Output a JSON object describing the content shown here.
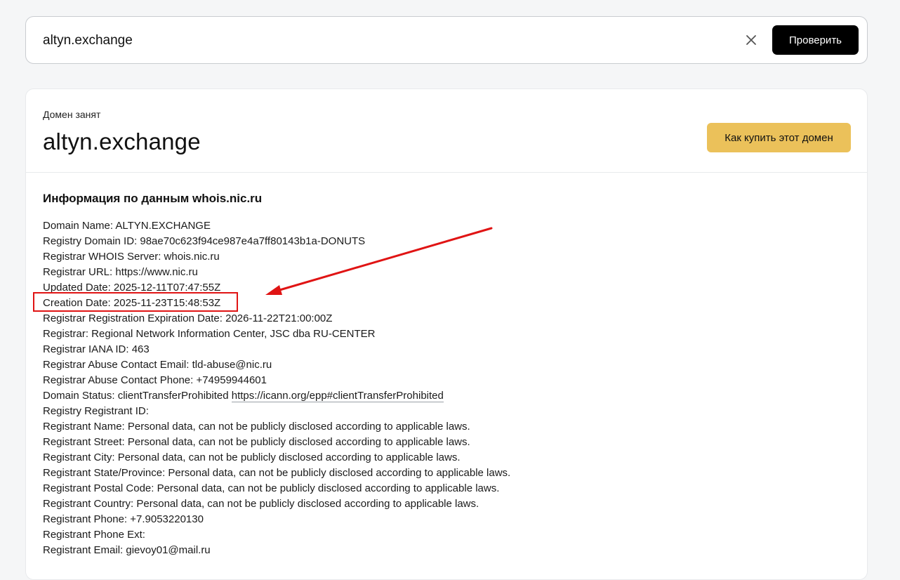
{
  "search": {
    "value": "altyn.exchange",
    "submit_label": "Проверить",
    "clear_icon": "close-icon"
  },
  "result": {
    "status": "Домен занят",
    "domain": "altyn.exchange",
    "buy_label": "Как купить этот домен",
    "buy_color": "#ebc15a"
  },
  "whois": {
    "heading": "Информация по данным whois.nic.ru",
    "lines": [
      {
        "text": "Domain Name: ALTYN.EXCHANGE"
      },
      {
        "text": "Registry Domain ID: 98ae70c623f94ce987e4a7ff80143b1a-DONUTS"
      },
      {
        "text": "Registrar WHOIS Server: whois.nic.ru"
      },
      {
        "text": "Registrar URL: https://www.nic.ru"
      },
      {
        "text": "Updated Date: 2025-12-11T07:47:55Z"
      },
      {
        "text": "Creation Date: 2025-11-23T15:48:53Z",
        "highlighted": true
      },
      {
        "text": "Registrar Registration Expiration Date: 2026-11-22T21:00:00Z"
      },
      {
        "text": "Registrar: Regional Network Information Center, JSC dba RU-CENTER"
      },
      {
        "text": "Registrar IANA ID: 463"
      },
      {
        "text": "Registrar Abuse Contact Email: tld-abuse@nic.ru"
      },
      {
        "text": "Registrar Abuse Contact Phone: +74959944601"
      },
      {
        "prefix": "Domain Status: clientTransferProhibited ",
        "link": "https://icann.org/epp#clientTransferProhibited"
      },
      {
        "text": "Registry Registrant ID:"
      },
      {
        "text": "Registrant Name: Personal data, can not be publicly disclosed according to applicable laws."
      },
      {
        "text": "Registrant Street: Personal data, can not be publicly disclosed according to applicable laws."
      },
      {
        "text": "Registrant City: Personal data, can not be publicly disclosed according to applicable laws."
      },
      {
        "text": "Registrant State/Province: Personal data, can not be publicly disclosed according to applicable laws."
      },
      {
        "text": "Registrant Postal Code: Personal data, can not be publicly disclosed according to applicable laws."
      },
      {
        "text": "Registrant Country: Personal data, can not be publicly disclosed according to applicable laws."
      },
      {
        "text": "Registrant Phone: +7.9053220130"
      },
      {
        "text": "Registrant Phone Ext:"
      },
      {
        "text": "Registrant Email: gievoy01@mail.ru"
      }
    ]
  },
  "annotation": {
    "color": "#e01414"
  }
}
